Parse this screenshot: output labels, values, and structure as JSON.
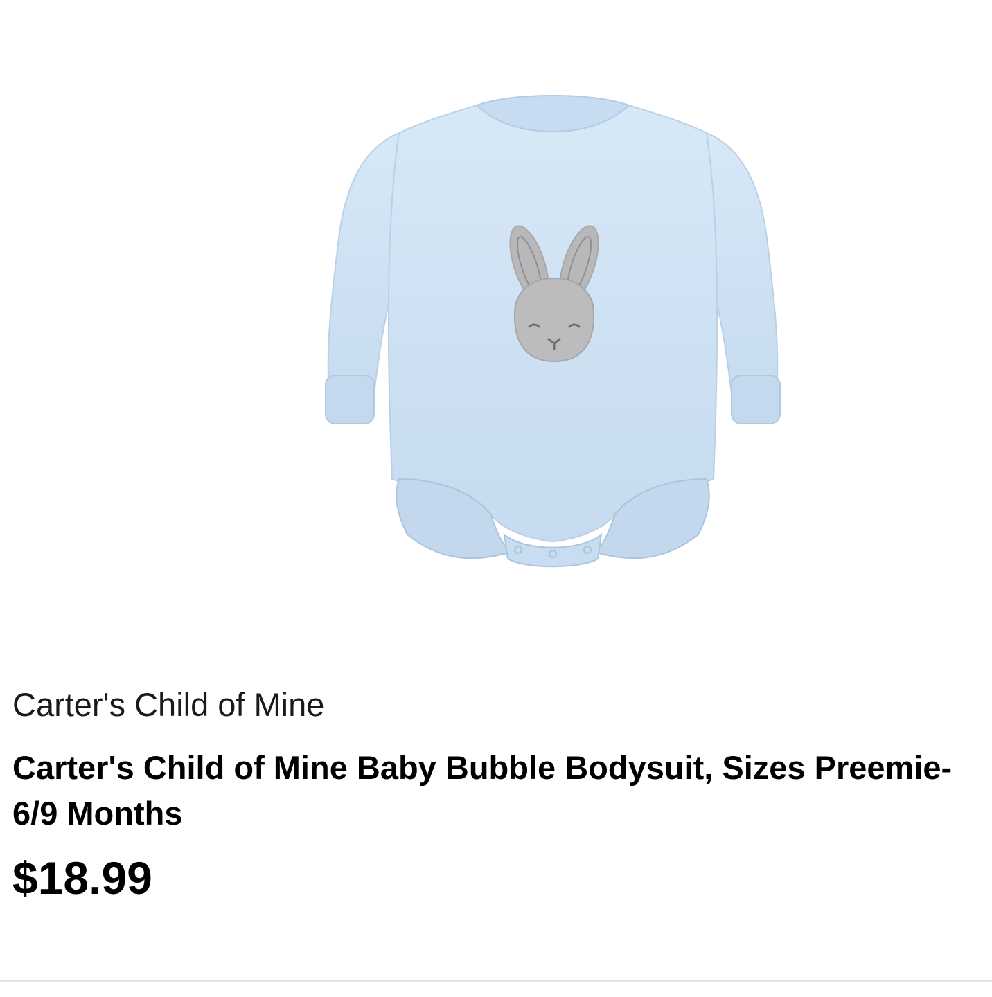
{
  "product": {
    "image_subject": "light blue long-sleeve bubble bodysuit with gray bunny face appliqué",
    "brand": "Carter's Child of Mine",
    "title": "Carter's Child of Mine Baby Bubble Bodysuit, Sizes Preemie-6/9 Months",
    "price": "$18.99"
  },
  "colors": {
    "fabric": "#cfe2f3",
    "fabric_shadow": "#b7cfe6",
    "bunny": "#b9b9bb",
    "text": "#000000",
    "divider": "#e3e4e5"
  }
}
